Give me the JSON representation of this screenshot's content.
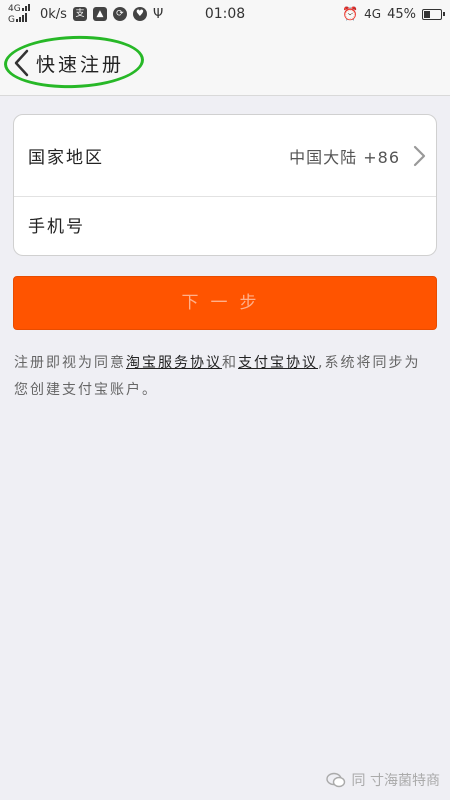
{
  "status_bar": {
    "signal": "4G",
    "speed": "0k/s",
    "time": "01:08",
    "network": "4G",
    "battery": "45%",
    "battery_level": 0.45
  },
  "header": {
    "title": "快速注册",
    "back_icon": "chevron-left-icon"
  },
  "form": {
    "country_label": "国家地区",
    "country_value": "中国大陆 +86",
    "phone_placeholder": "手机号"
  },
  "next_button_label": "下一步",
  "agreement": {
    "prefix": "注册即视为同意",
    "link1": "淘宝服务协议",
    "middle": "和",
    "link2": "支付宝协议",
    "suffix": ",系统将同步为您创建支付宝账户。"
  },
  "watermark": {
    "text": "同 寸海菌特商"
  },
  "colors": {
    "accent": "#ff5400",
    "highlight_circle": "#27b827"
  }
}
